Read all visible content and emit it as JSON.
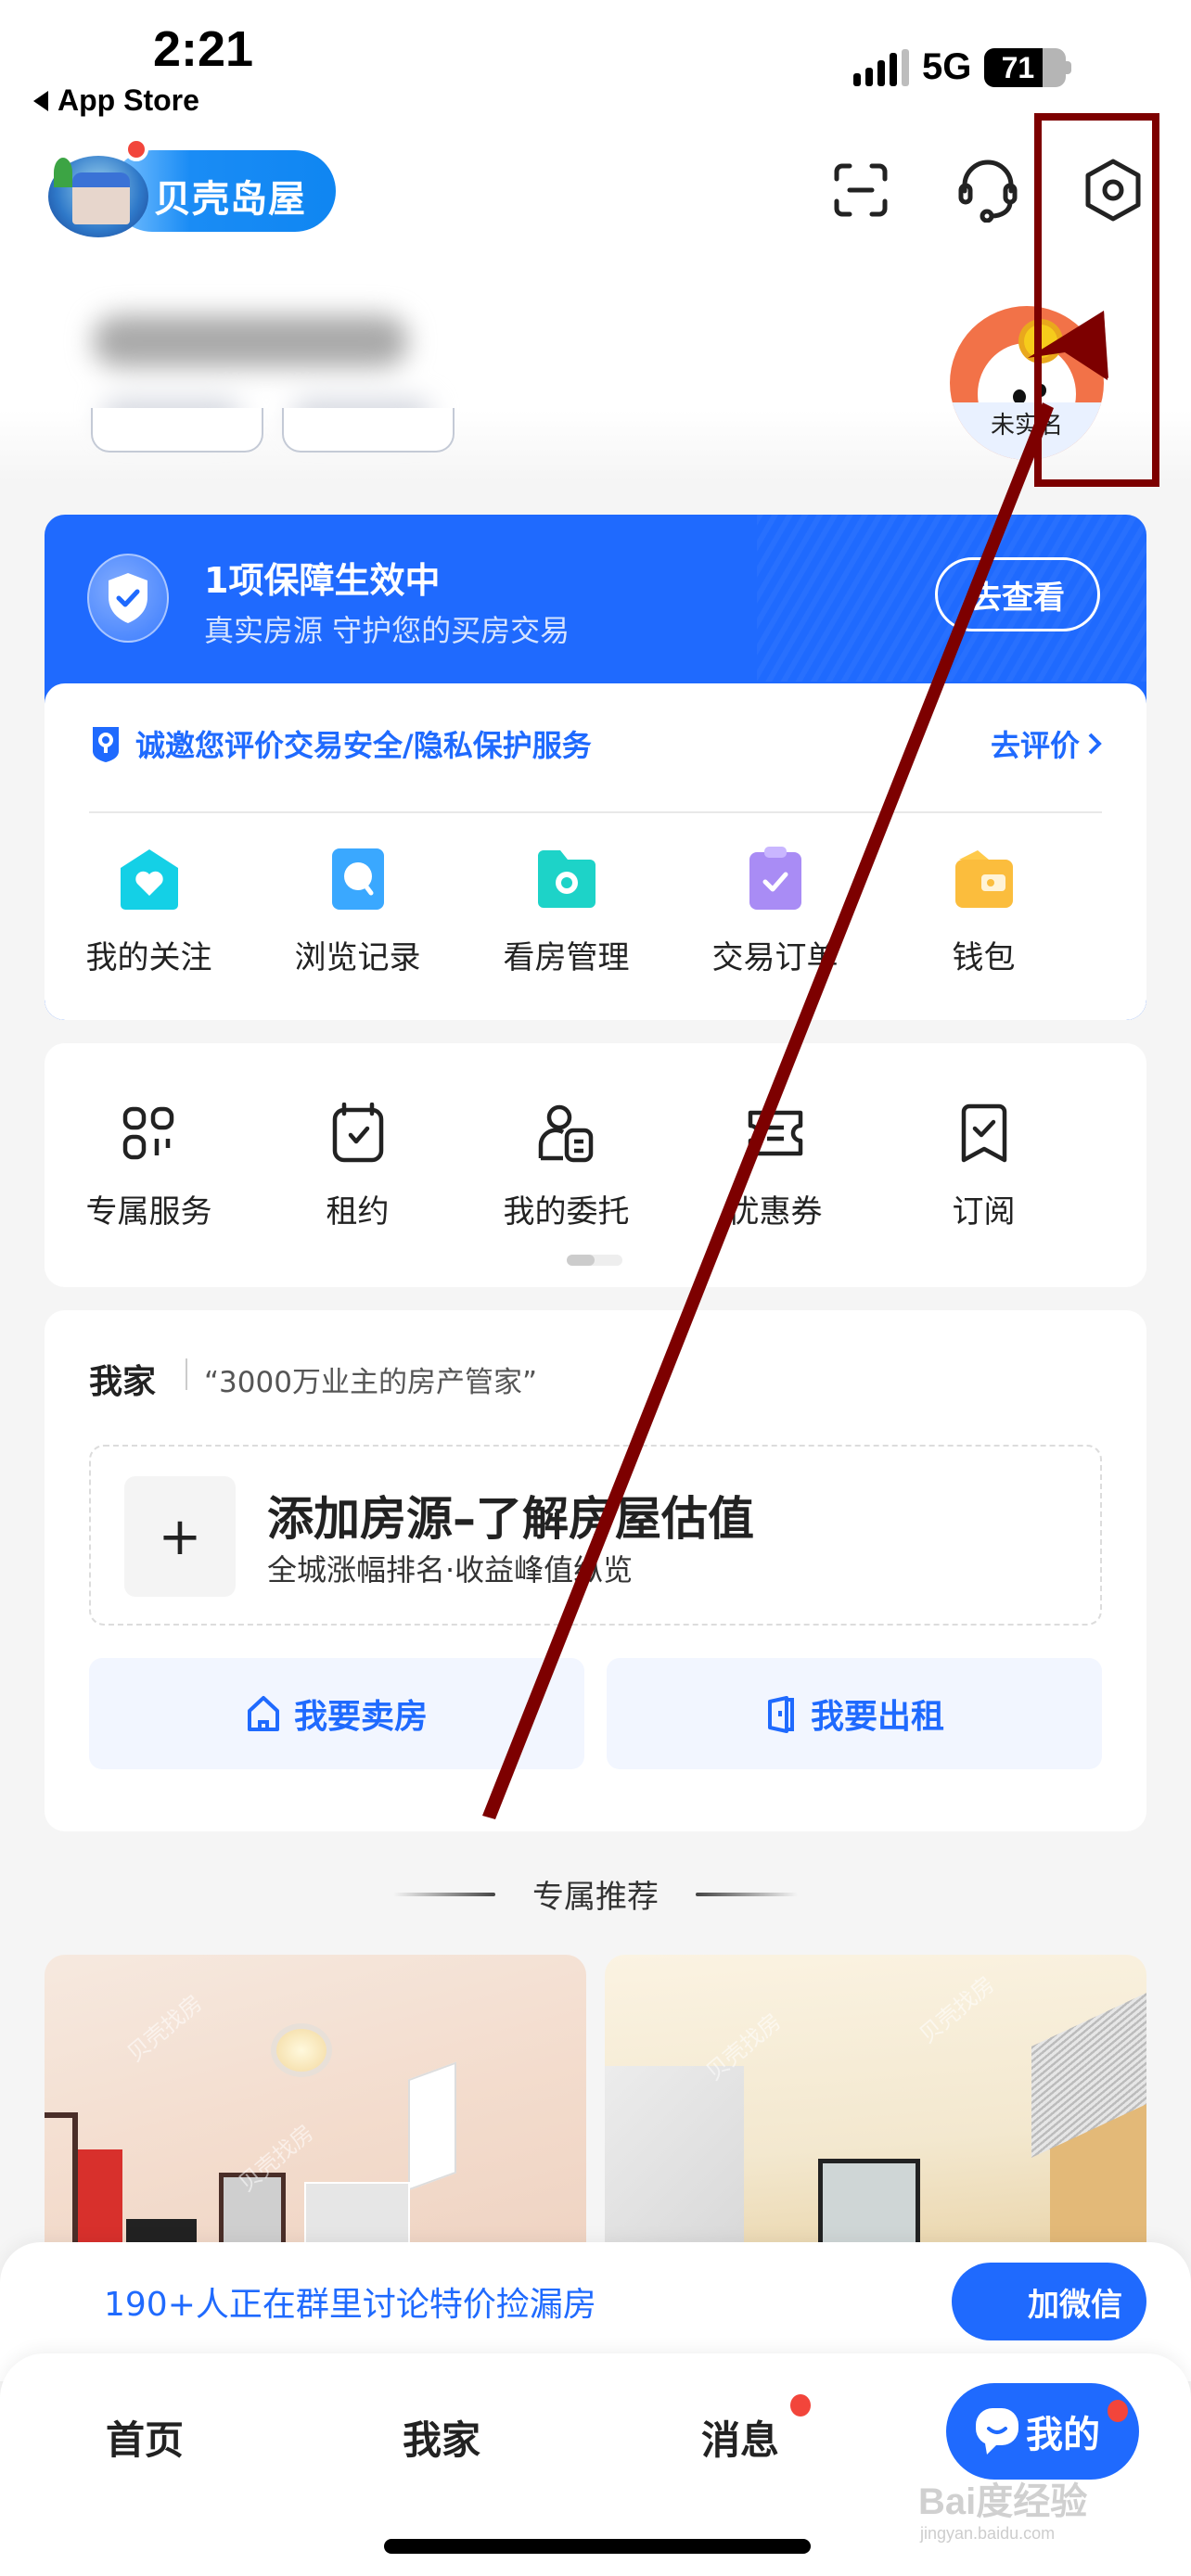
{
  "status_bar": {
    "time": "2:21",
    "back_label": "App Store",
    "network": "5G",
    "battery_percent": 71,
    "battery_text": "71"
  },
  "header": {
    "logo_text": "贝壳岛屋",
    "icons": [
      "scan-icon",
      "headset-icon",
      "settings-icon"
    ]
  },
  "profile": {
    "name": "(blurred)",
    "avatar_label": "未实名"
  },
  "guarantee": {
    "title": "1项保障生效中",
    "subtitle": "真实房源 守护您的买房交易",
    "button": "去查看",
    "invite_text": "诚邀您评价交易安全/隐私保护服务",
    "invite_link": "去评价",
    "shortcuts": [
      {
        "label": "我的关注",
        "icon": "heart-house-icon",
        "color": "#14d0e6"
      },
      {
        "label": "浏览记录",
        "icon": "search-history-icon",
        "color": "#3aa8ff"
      },
      {
        "label": "看房管理",
        "icon": "folder-view-icon",
        "color": "#1dd3c8"
      },
      {
        "label": "交易订单",
        "icon": "clipboard-check-icon",
        "color": "#a98cf5"
      },
      {
        "label": "钱包",
        "icon": "wallet-icon",
        "color": "#fbbd3d"
      }
    ]
  },
  "services": {
    "items": [
      {
        "label": "专属服务",
        "icon": "apps-grid-icon"
      },
      {
        "label": "租约",
        "icon": "calendar-check-icon"
      },
      {
        "label": "我的委托",
        "icon": "person-doc-icon"
      },
      {
        "label": "优惠券",
        "icon": "ticket-icon"
      },
      {
        "label": "订阅",
        "icon": "bookmark-check-icon"
      }
    ],
    "page_index": 1,
    "page_count": 2
  },
  "home_section": {
    "title": "我家",
    "slogan": "“3000万业主的房产管家”",
    "add_title": "添加房源–了解房屋估值",
    "add_subtitle": "全城涨幅排名·收益峰值纵览",
    "add_plus": "+",
    "sell_button": "我要卖房",
    "rent_button": "我要出租"
  },
  "recommend": {
    "title": "专属推荐",
    "watermark": "贝壳找房"
  },
  "banner": {
    "text": "190+人正在群里讨论特价捡漏房",
    "button": "加微信"
  },
  "tabbar": {
    "tabs": [
      {
        "label": "首页",
        "active": false,
        "badge": false
      },
      {
        "label": "我家",
        "active": false,
        "badge": false
      },
      {
        "label": "消息",
        "active": false,
        "badge": true
      },
      {
        "label": "我的",
        "active": true,
        "badge": true
      }
    ]
  },
  "watermark": {
    "brand": "Bai度经验",
    "url": "jingyan.baidu.com"
  },
  "annotation": {
    "color": "#7d0000",
    "target": "settings-icon"
  }
}
